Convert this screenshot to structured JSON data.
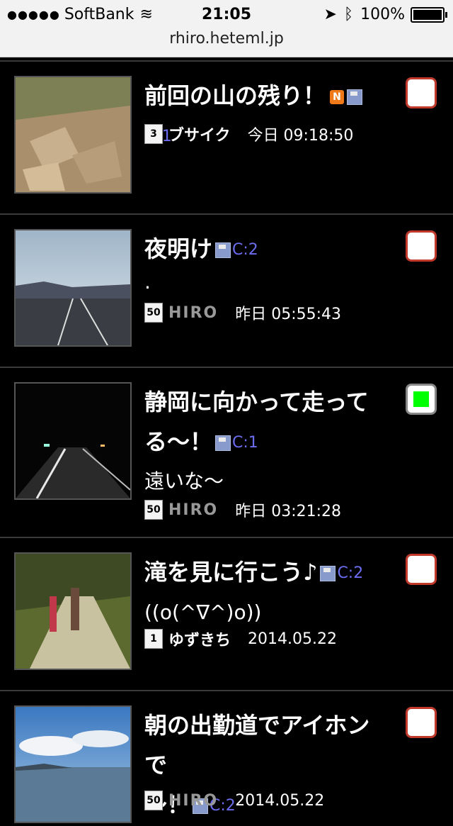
{
  "status": {
    "carrier": "SoftBank",
    "time": "21:05",
    "battery": "100%",
    "url": "rhiro.heteml.jp"
  },
  "posts": [
    {
      "title": "前回の山の残り！",
      "n_badge": "N",
      "comments": "C:1",
      "rank": "3",
      "author": "ブサイク",
      "time": "今日 09:18:50",
      "checked": false
    },
    {
      "title": "夜明け",
      "comments": "C:2",
      "body": ".",
      "rank": "50",
      "author": "HIRO",
      "time": "昨日 05:55:43",
      "checked": false
    },
    {
      "title_line1": "静岡に向かって走って",
      "title_line2": "る〜！",
      "comments": "C:1",
      "body": "遠いな〜",
      "rank": "50",
      "author": "HIRO",
      "time": "昨日 03:21:28",
      "checked": true
    },
    {
      "title": "滝を見に行こう♪",
      "comments": "C:2",
      "body": "((o(^∇^)o))",
      "rank": "1",
      "author": "ゆずきち",
      "time": "2014.05.22",
      "checked": false
    },
    {
      "title_line1": "朝の出勤道でアイホンで",
      "title_line2": "〜！",
      "comments": "C:2",
      "rank": "50",
      "author": "HIRO",
      "time": "2014.05.22",
      "checked": false
    }
  ]
}
